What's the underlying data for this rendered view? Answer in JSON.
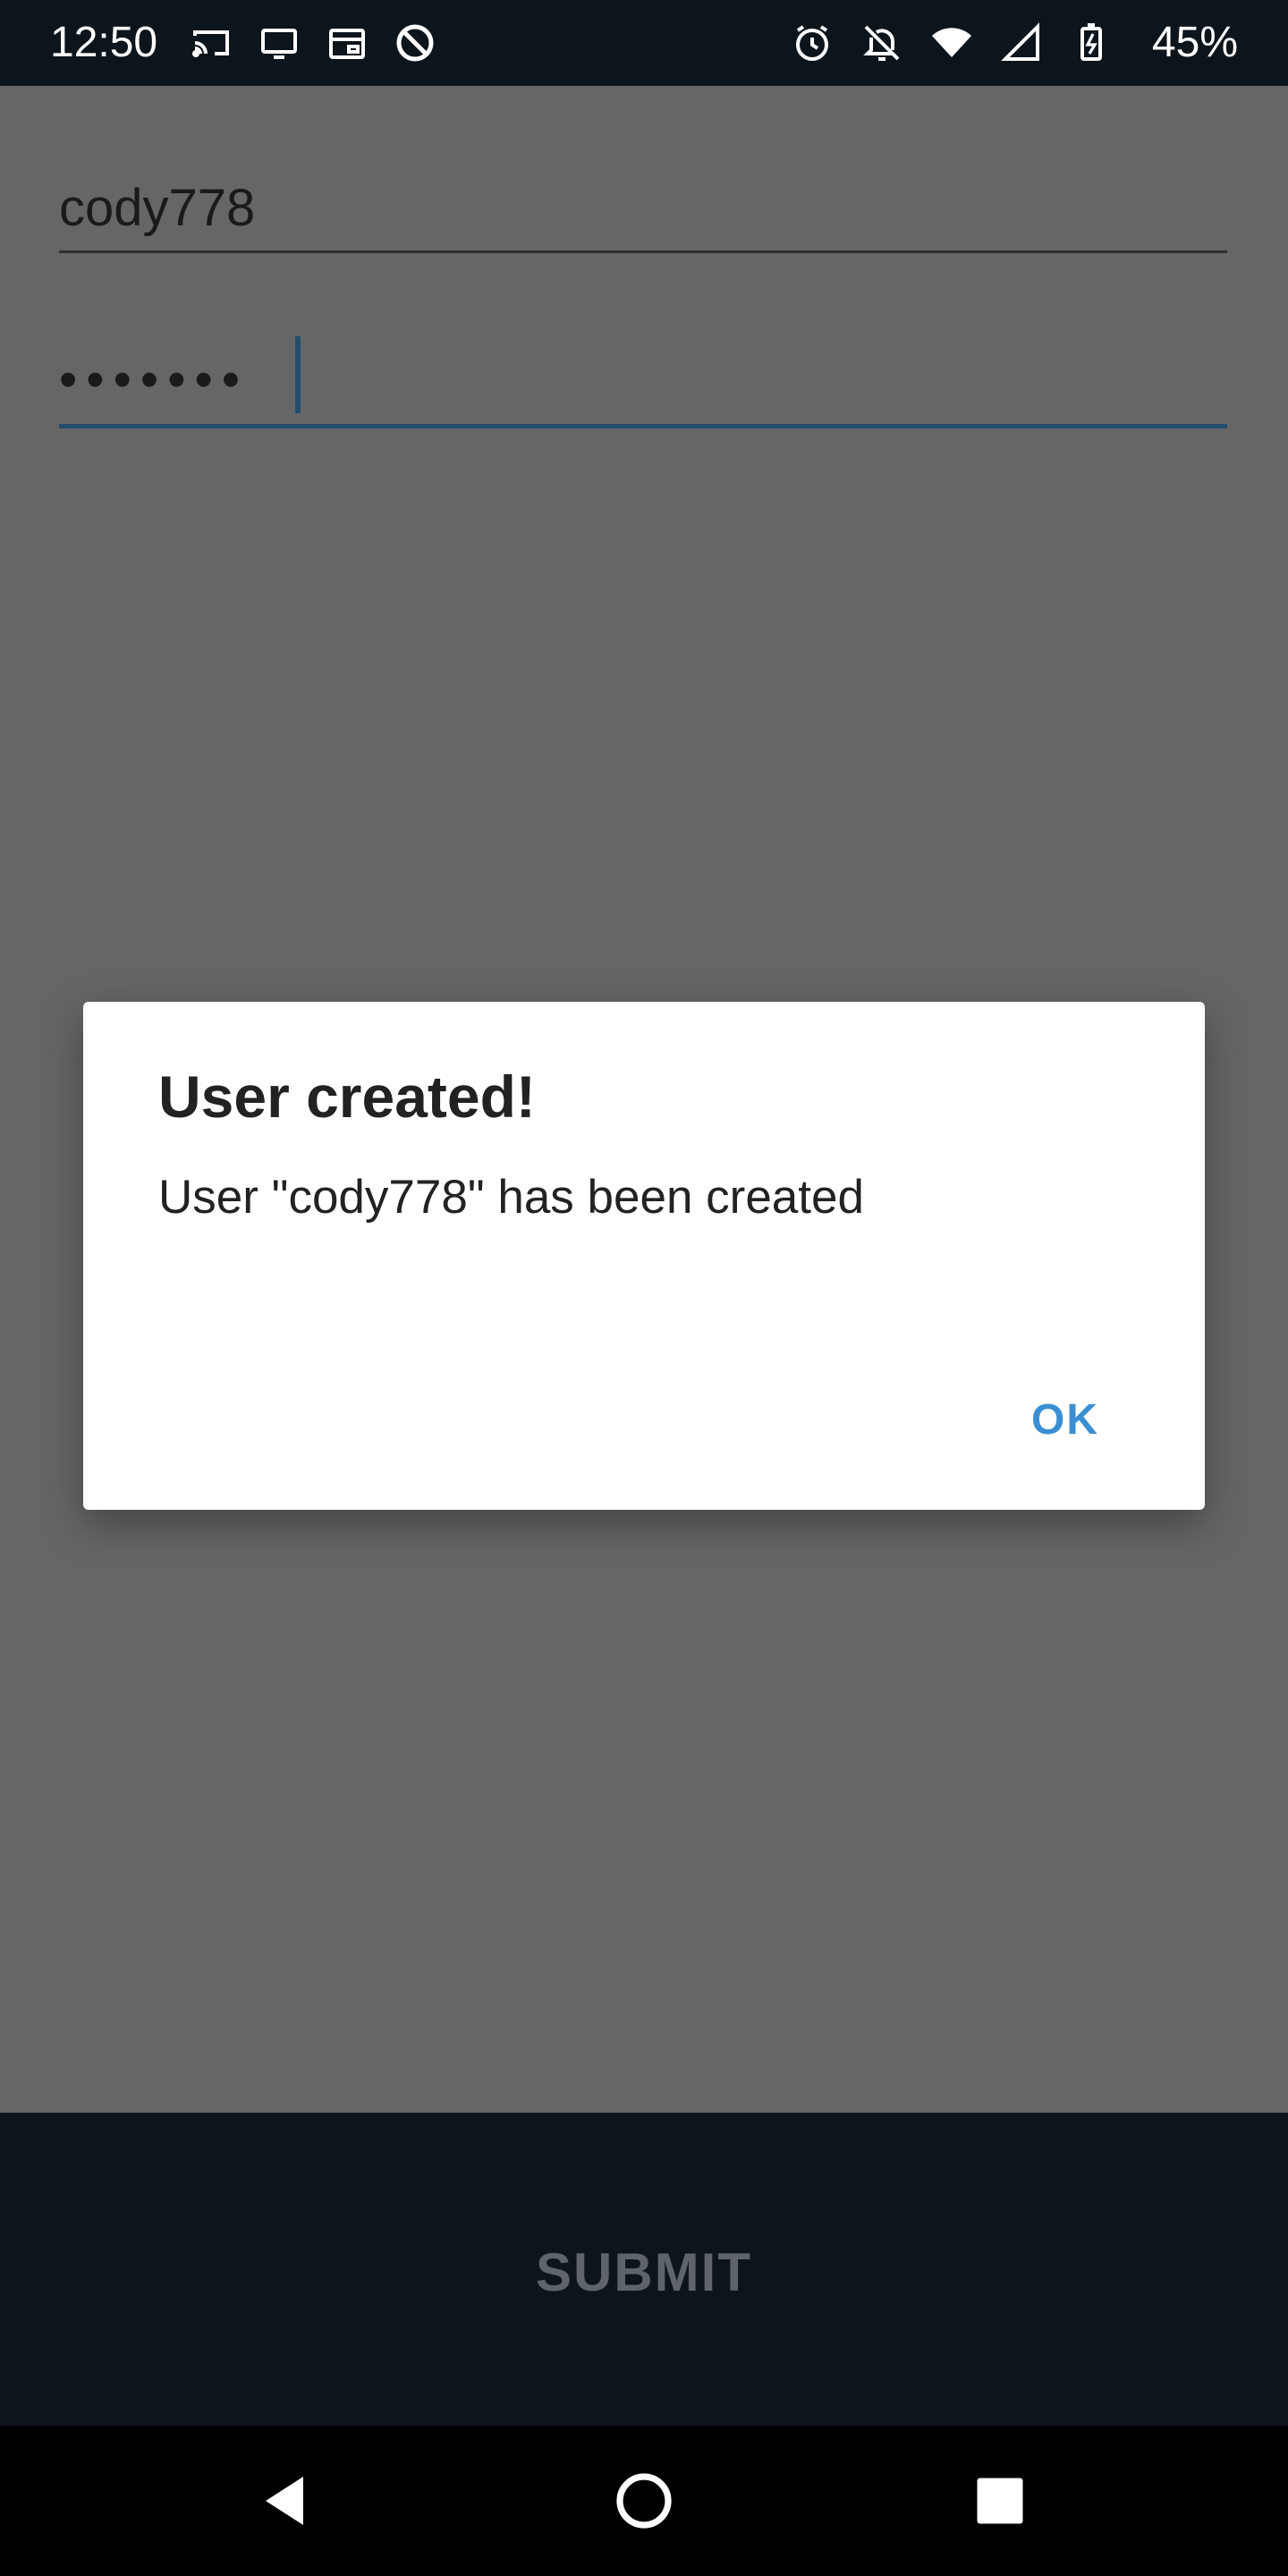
{
  "status_bar": {
    "time": "12:50",
    "left_icons": [
      "cast-icon",
      "monitor-icon",
      "calendar-icon",
      "no-entry-icon"
    ],
    "right_icons": [
      "alarm-icon",
      "notifications-off-icon",
      "wifi-icon",
      "signal-icon",
      "battery-charging-icon"
    ],
    "battery": "45%"
  },
  "form": {
    "username": "cody778",
    "password_masked": "•••••••"
  },
  "dialog": {
    "title": "User created!",
    "message": "User \"cody778\" has been created",
    "ok_label": "OK"
  },
  "submit": {
    "label": "SUBMIT"
  },
  "nav": {
    "icons": [
      "back-icon",
      "home-icon",
      "recents-icon"
    ]
  },
  "colors": {
    "status_bar_bg": "#0d151c",
    "scrim": "#666666",
    "accent": "#3a8fd3",
    "submit_text": "#5e6469"
  }
}
